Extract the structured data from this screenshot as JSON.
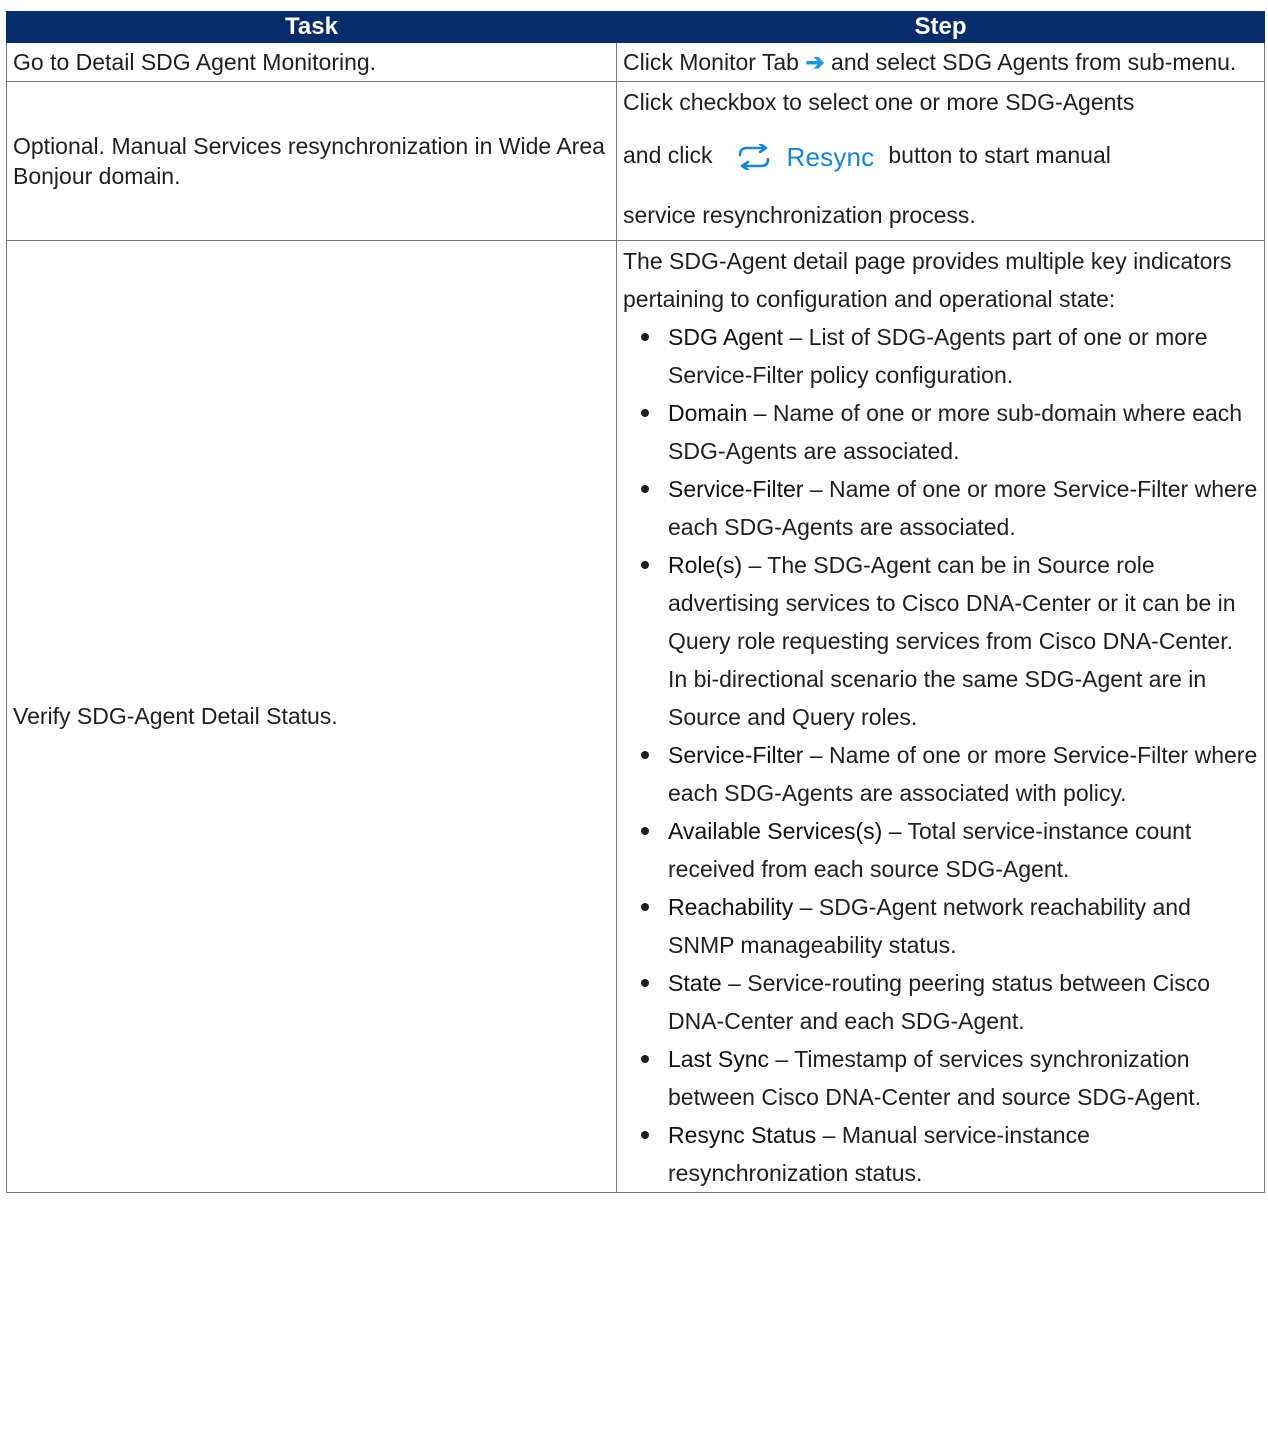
{
  "table": {
    "headers": {
      "task": "Task",
      "step": "Step"
    },
    "row1": {
      "task": "Go to Detail SDG Agent Monitoring.",
      "step_before": "Click Monitor Tab",
      "arrow": "➔",
      "step_after": "and select SDG Agents from sub-menu."
    },
    "row2": {
      "task": "Optional. Manual Services resynchronization in Wide Area Bonjour domain.",
      "step_line1": "Click checkbox to select one or more SDG-Agents",
      "step_before_button": "and click",
      "button_label": "Resync",
      "button_icon": "resync-arrows-icon",
      "step_after_button": "button to start manual",
      "step_line3": "service resynchronization process."
    },
    "row3": {
      "task": "Verify SDG-Agent Detail Status.",
      "intro": "The SDG-Agent detail page provides multiple key indicators pertaining to configuration and operational state:",
      "items": [
        {
          "term": "SDG Agent",
          "desc": " – List of SDG-Agents part of one or more Service-Filter policy configuration."
        },
        {
          "term": "Domain",
          "desc": " – Name of one or more sub-domain where each SDG-Agents are associated."
        },
        {
          "term": "Service-Filter",
          "desc": " – Name of one or more Service-Filter where each SDG-Agents are associated."
        },
        {
          "term": "Role(s)",
          "desc": " – The SDG-Agent can be in Source role advertising services to Cisco DNA-Center or it can be in Query role requesting services from Cisco DNA-Center. In bi-directional scenario the same SDG-Agent are in Source and Query roles."
        },
        {
          "term": "Service-Filter",
          "desc": " – Name of one or more Service-Filter where each SDG-Agents are associated with policy."
        },
        {
          "term": "Available Services(s)",
          "desc": " – Total service-instance count received from each source SDG-Agent."
        },
        {
          "term": "Reachability",
          "desc": " – SDG-Agent network reachability and SNMP manageability status."
        },
        {
          "term": "State",
          "desc": " – Service-routing peering status between Cisco DNA-Center and each SDG-Agent."
        },
        {
          "term": "Last Sync",
          "desc": " – Timestamp of services synchronization between Cisco DNA-Center and source SDG-Agent."
        },
        {
          "term": "Resync Status",
          "desc": " – Manual service-instance resynchronization status."
        }
      ]
    }
  },
  "colors": {
    "header_bg": "#062c6b",
    "header_text": "#ffffff",
    "accent_blue": "#1a84d4",
    "arrow_blue": "#1a9bd7",
    "border": "#7a7a7a"
  }
}
